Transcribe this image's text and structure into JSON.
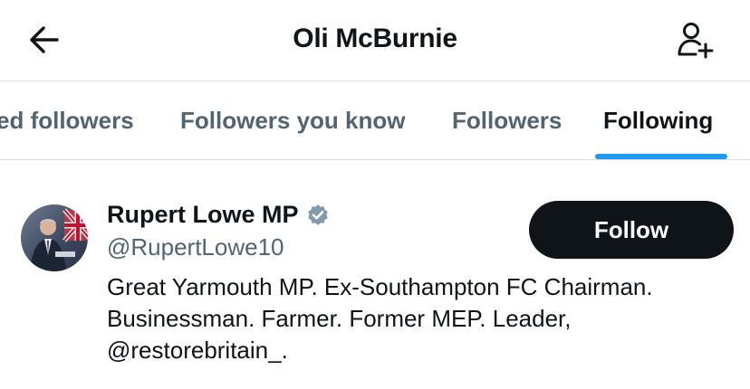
{
  "header": {
    "title": "Oli McBurnie",
    "back_icon": "arrow-left-icon",
    "add_icon": "person-plus-icon"
  },
  "tabs": [
    {
      "label": "Verified followers",
      "visible_label": "ed followers",
      "active": false
    },
    {
      "label": "Followers you know",
      "active": false
    },
    {
      "label": "Followers",
      "active": false
    },
    {
      "label": "Following",
      "active": true
    }
  ],
  "colors": {
    "accent": "#1d9bf0",
    "text_primary": "#0f1419",
    "text_secondary": "#536471",
    "button_bg": "#0f1419",
    "verified_badge": "#829aab"
  },
  "users": [
    {
      "display_name": "Rupert Lowe MP",
      "verified_icon": "verified-badge-icon",
      "handle": "@RupertLowe10",
      "follow_label": "Follow",
      "bio_lines": [
        "Great Yarmouth MP. Ex-Southampton FC Chairman.",
        "Businessman. Farmer. Former MEP. Leader,",
        "@restorebritain_."
      ]
    }
  ]
}
